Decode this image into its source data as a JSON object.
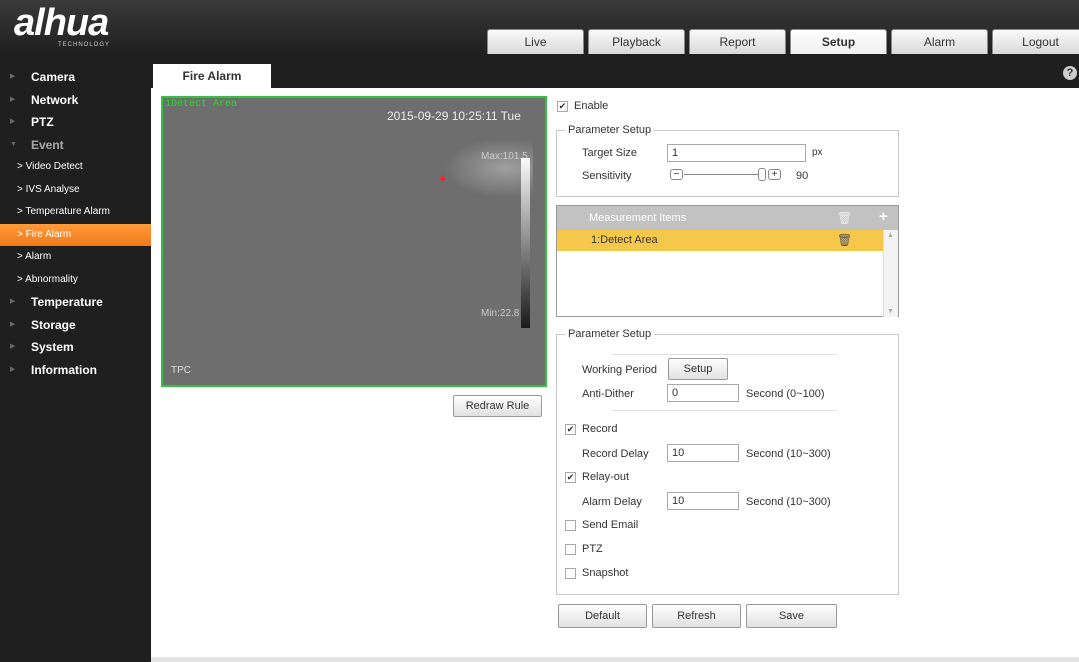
{
  "brand": {
    "logo": "alhua",
    "logo_sub": "TECHNOLOGY"
  },
  "nav_tabs": [
    "Live",
    "Playback",
    "Report",
    "Setup",
    "Alarm",
    "Logout"
  ],
  "page_tab": "Fire Alarm",
  "sidebar": {
    "items": [
      {
        "label": "Camera"
      },
      {
        "label": "Network"
      },
      {
        "label": "PTZ"
      },
      {
        "label": "Event"
      },
      {
        "label": "> Video Detect"
      },
      {
        "label": "> IVS Analyse"
      },
      {
        "label": "> Temperature Alarm"
      },
      {
        "label": "> Fire Alarm"
      },
      {
        "label": "> Alarm"
      },
      {
        "label": "> Abnormality"
      },
      {
        "label": "Temperature"
      },
      {
        "label": "Storage"
      },
      {
        "label": "System"
      },
      {
        "label": "Information"
      }
    ]
  },
  "video": {
    "area_label": "1Detect Area",
    "timestamp": "2015-09-29 10:25:11 Tue",
    "max_label": "Max:101.5",
    "min_label": "Min:22.8",
    "channel": "TPC"
  },
  "redraw_button": "Redraw Rule",
  "enable_label": "Enable",
  "param_setup_1": {
    "legend": "Parameter Setup",
    "target_size_label": "Target Size",
    "target_size_value": "1",
    "target_size_unit": "px",
    "sensitivity_label": "Sensitivity",
    "sensitivity_value": "90"
  },
  "measurement": {
    "header": "Measurement Items",
    "rows": [
      {
        "label": "1:Detect Area"
      }
    ]
  },
  "param_setup_2": {
    "legend": "Parameter Setup",
    "working_period_label": "Working Period",
    "setup_button": "Setup",
    "anti_dither_label": "Anti-Dither",
    "anti_dither_value": "0",
    "anti_dither_unit": "Second (0~100)",
    "record_label": "Record",
    "record_delay_label": "Record Delay",
    "record_delay_value": "10",
    "record_delay_unit": "Second (10~300)",
    "relay_out_label": "Relay-out",
    "alarm_delay_label": "Alarm Delay",
    "alarm_delay_value": "10",
    "alarm_delay_unit": "Second (10~300)",
    "send_email_label": "Send Email",
    "ptz_label": "PTZ",
    "snapshot_label": "Snapshot"
  },
  "footer_buttons": {
    "default": "Default",
    "refresh": "Refresh",
    "save": "Save"
  },
  "help_icon": "?",
  "colors": {
    "accent": "#f07a1a",
    "highlight_row": "#f5c84b",
    "detect_border": "#2fc43a"
  }
}
